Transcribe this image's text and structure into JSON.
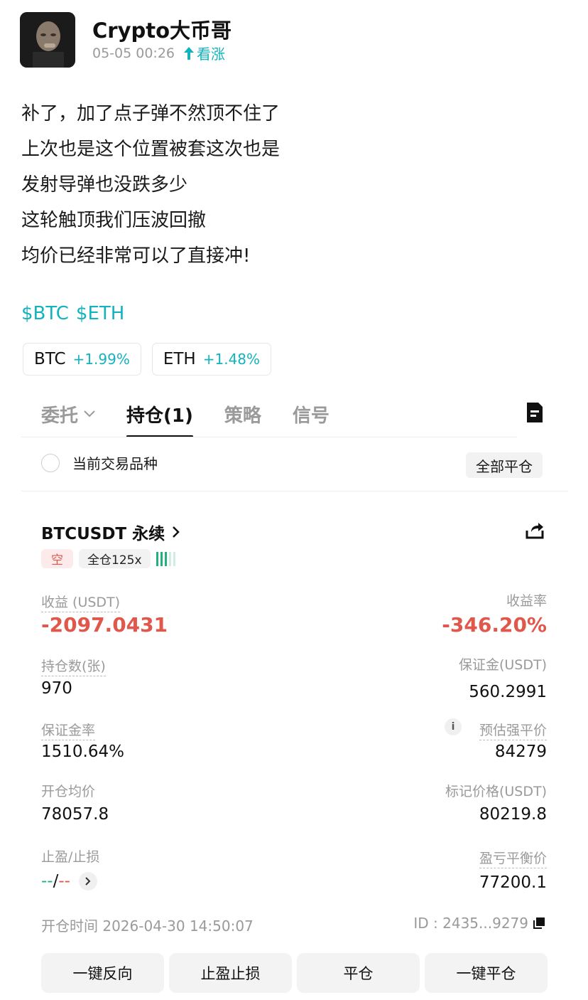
{
  "author": {
    "name": "Crypto大币哥",
    "time": "05-05 00:26",
    "sentiment": "看涨",
    "avatar_icon": "avatar-portrait"
  },
  "post": {
    "lines": [
      "补了，加了点子弹不然顶不住了",
      "上次也是这个位置被套这次也是",
      "发射导弹也没跌多少",
      "这轮触顶我们压波回撤",
      "均价已经非常可以了直接冲!"
    ],
    "tags": [
      "$BTC",
      "$ETH"
    ],
    "chips": [
      {
        "symbol": "BTC",
        "change": "+1.99%"
      },
      {
        "symbol": "ETH",
        "change": "+1.48%"
      }
    ]
  },
  "tabs": {
    "items": [
      "委托",
      "持仓(1)",
      "策略",
      "信号"
    ],
    "active_index": 1
  },
  "filter": {
    "label": "当前交易品种",
    "close_all": "全部平仓"
  },
  "position": {
    "symbol": "BTCUSDT 永续",
    "side": "空",
    "margin_mode": "全仓125x",
    "pnl_label": "收益 (USDT)",
    "pnl_value": "-2097.0431",
    "roe_label": "收益率",
    "roe_value": "-346.20%",
    "size_label": "持仓数(张)",
    "size_value": "970",
    "margin_label": "保证金(USDT)",
    "margin_value": "560.2991",
    "margin_ratio_label": "保证金率",
    "margin_ratio_value": "1510.64%",
    "liq_label": "预估强平价",
    "liq_value": "84279",
    "entry_label": "开仓均价",
    "entry_value": "78057.8",
    "mark_label": "标记价格(USDT)",
    "mark_value": "80219.8",
    "tpsl_label": "止盈/止损",
    "tp_value": "--",
    "sl_value": "--",
    "breakeven_label": "盈亏平衡价",
    "breakeven_value": "77200.1",
    "open_time": "开仓时间 2026-04-30 14:50:07",
    "position_id": "ID : 2435...9279"
  },
  "actions": [
    "一键反向",
    "止盈止损",
    "平仓",
    "一键平仓"
  ],
  "colors": {
    "accent": "#13b3bd",
    "loss": "#e0574b",
    "gain": "#22b07d"
  }
}
